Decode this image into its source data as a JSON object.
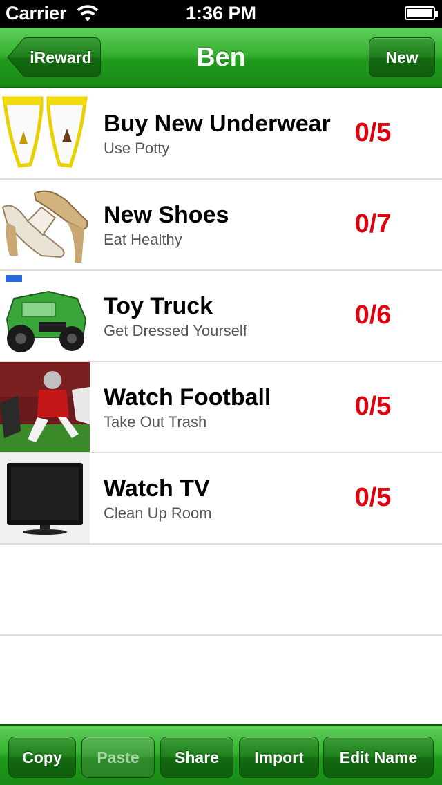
{
  "status_bar": {
    "carrier": "Carrier",
    "time": "1:36 PM",
    "wifi_icon": "wifi-icon",
    "battery_icon": "battery-icon",
    "battery_level": 0.9
  },
  "nav": {
    "title": "Ben",
    "back_label": "iReward",
    "new_label": "New"
  },
  "rewards": [
    {
      "title": "Buy New Underwear",
      "subtitle": "Use Potty",
      "count": "0/5",
      "image": "underwear-image"
    },
    {
      "title": "New Shoes",
      "subtitle": "Eat Healthy",
      "count": "0/7",
      "image": "shoes-image"
    },
    {
      "title": "Toy Truck",
      "subtitle": "Get Dressed Yourself",
      "count": "0/6",
      "image": "toy-truck-image"
    },
    {
      "title": "Watch Football",
      "subtitle": "Take Out Trash",
      "count": "0/5",
      "image": "football-image"
    },
    {
      "title": "Watch TV",
      "subtitle": "Clean Up Room",
      "count": "0/5",
      "image": "tv-image"
    }
  ],
  "toolbar": {
    "copy_label": "Copy",
    "paste_label": "Paste",
    "share_label": "Share",
    "import_label": "Import",
    "edit_name_label": "Edit Name"
  },
  "colors": {
    "nav_green": "#2fa82b",
    "count_red": "#e0000e"
  }
}
